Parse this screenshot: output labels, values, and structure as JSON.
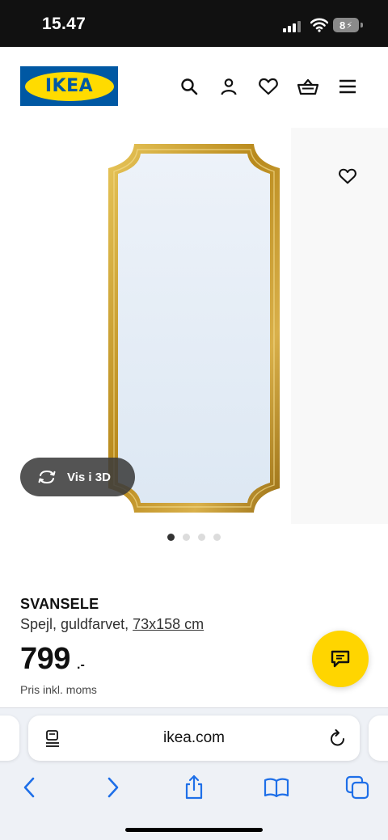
{
  "status_bar": {
    "time": "15.47",
    "battery": "8"
  },
  "header": {
    "logo_text": "IKEA",
    "icons": [
      "search-icon",
      "account-icon",
      "favourites-icon",
      "basket-icon",
      "menu-icon"
    ]
  },
  "gallery": {
    "view_3d_label": "Vis i 3D",
    "dot_count": 4,
    "active_dot": 0
  },
  "product": {
    "name": "SVANSELE",
    "description": "Spejl, guldfarvet,",
    "size": "73x158 cm",
    "price": "799",
    "price_suffix": ".-",
    "price_note": "Pris inkl. moms"
  },
  "browser": {
    "url": "ikea.com"
  },
  "colors": {
    "ikea_blue": "#0058a3",
    "ikea_yellow": "#ffdb00",
    "chat_yellow": "#ffd500",
    "ios_blue": "#1e6fe8",
    "frame_gold": "#c9a227"
  }
}
